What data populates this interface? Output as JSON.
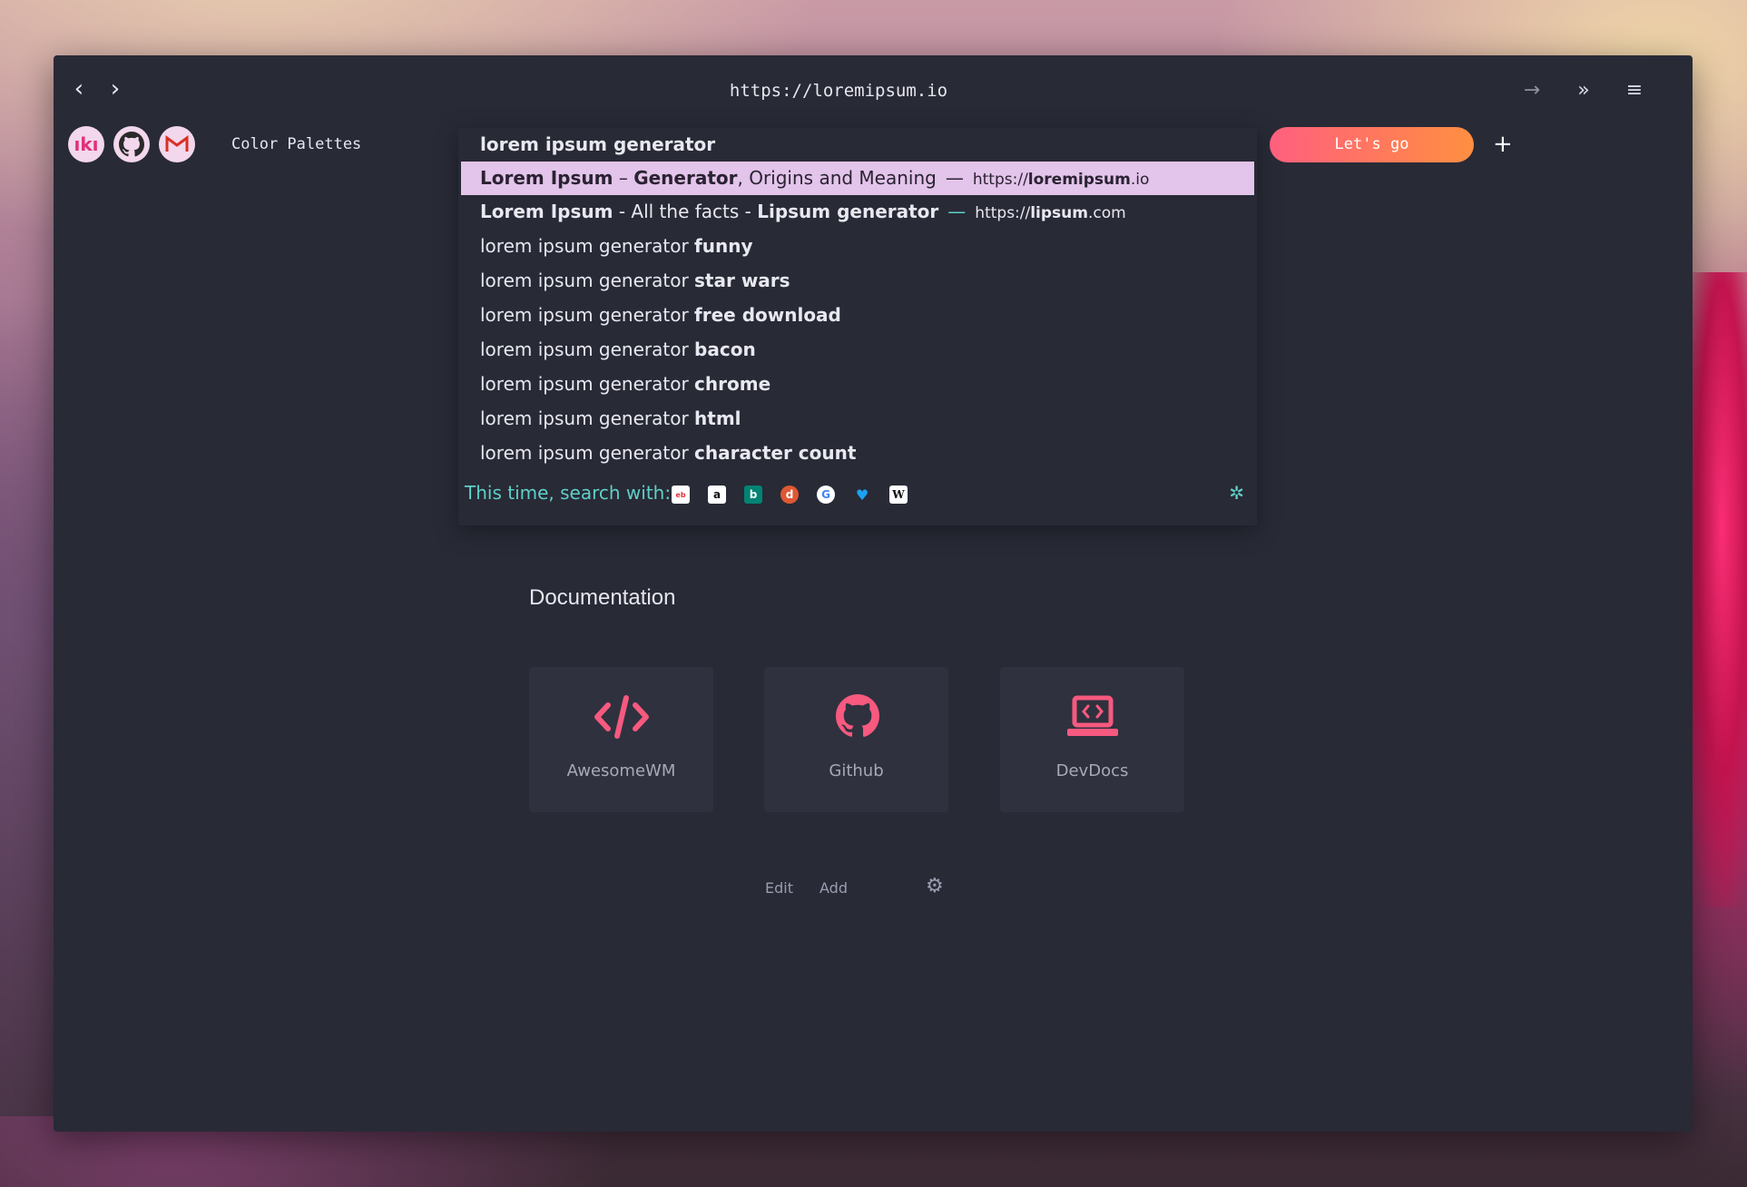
{
  "browser": {
    "url": "https://loremipsum.io"
  },
  "favorites": {
    "items": [
      {
        "icon": "iki-icon",
        "color": "#e0307a"
      },
      {
        "icon": "github-icon",
        "color": "#2a2a2a"
      },
      {
        "icon": "gmail-icon",
        "color": "#d93025"
      }
    ],
    "label": "Color Palettes"
  },
  "search": {
    "suggestions": [
      {
        "text": "lorem ipsum generator"
      },
      {
        "title_bold_1": "Lorem Ipsum",
        "title_plain_1": " – ",
        "title_bold_2": "Generator",
        "title_plain_2": ", Origins and Meaning",
        "dash": "—",
        "url_prefix": "https://",
        "url_bold": "loremipsum",
        "url_suffix": ".io"
      },
      {
        "title_bold_1": "Lorem Ipsum",
        "title_plain_1": " - All the facts - ",
        "title_bold_2": "Lipsum generator",
        "dash": "—",
        "url_prefix": "https://",
        "url_bold": "lipsum",
        "url_suffix": ".com"
      },
      {
        "prefix": "lorem ipsum generator ",
        "suffix": "funny"
      },
      {
        "prefix": "lorem ipsum generator ",
        "suffix": "star wars"
      },
      {
        "prefix": "lorem ipsum generator ",
        "suffix": "free download"
      },
      {
        "prefix": "lorem ipsum generator ",
        "suffix": "bacon"
      },
      {
        "prefix": "lorem ipsum generator ",
        "suffix": "chrome"
      },
      {
        "prefix": "lorem ipsum generator ",
        "suffix": "html"
      },
      {
        "prefix": "lorem ipsum generator ",
        "suffix": "character count"
      }
    ],
    "search_with_label": "This time, search with:",
    "engines": [
      "ebay-icon",
      "amazon-icon",
      "bing-icon",
      "duckduckgo-icon",
      "google-icon",
      "twitter-icon",
      "wikipedia-icon"
    ],
    "go_label": "Let's go",
    "accent": "#5fd0c8",
    "selected_bg": "#e3c4ea"
  },
  "main": {
    "section_title": "Documentation",
    "cards": [
      {
        "label": "AwesomeWM",
        "icon": "code-icon"
      },
      {
        "label": "Github",
        "icon": "github-icon"
      },
      {
        "label": "DevDocs",
        "icon": "laptop-code-icon"
      }
    ],
    "edit_label": "Edit",
    "add_label": "Add",
    "accent": "#f7597f"
  }
}
